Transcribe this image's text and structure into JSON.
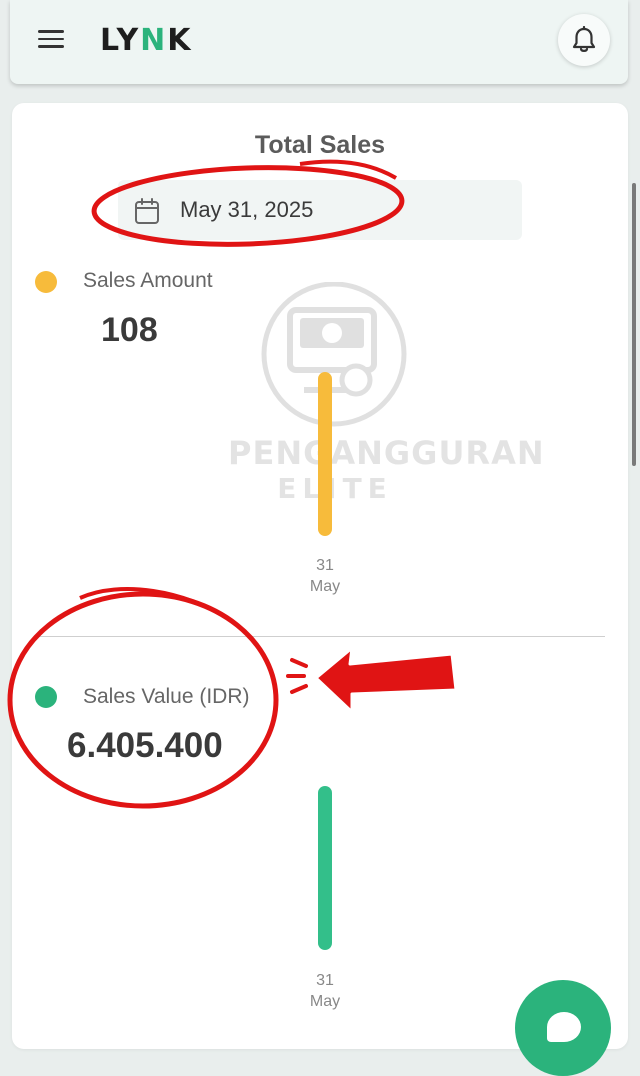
{
  "header": {
    "logo_prefix": "LY",
    "logo_mid": "N",
    "logo_suffix": "K"
  },
  "total_sales": {
    "title": "Total Sales",
    "date": "May 31, 2025"
  },
  "sales_amount": {
    "label": "Sales Amount",
    "value": "108",
    "dot_color": "#f7bb3b",
    "bar_color": "#f7bb3b",
    "tick_day": "31",
    "tick_month": "May"
  },
  "sales_value": {
    "label": "Sales Value (IDR)",
    "value": "6.405.400",
    "dot_color": "#2bb37c",
    "bar_color": "#33bf8a",
    "tick_day": "31",
    "tick_month": "May"
  },
  "watermark": {
    "line1": "PENGANGGURAN",
    "line2": "ELITE"
  },
  "colors": {
    "accent": "#2bb37c",
    "annotation": "#e01414"
  }
}
